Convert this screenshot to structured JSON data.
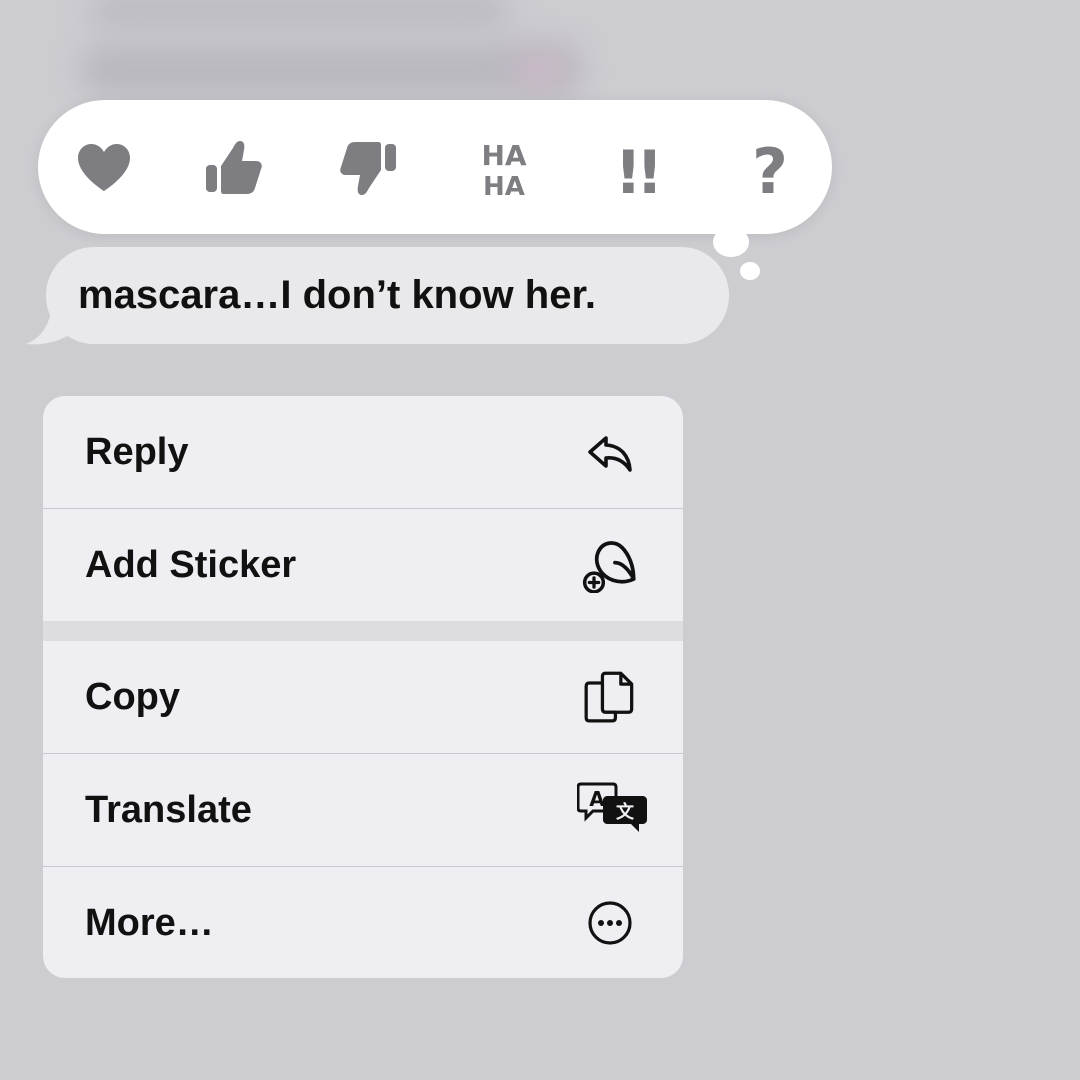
{
  "background": {
    "color": "#cdccd1"
  },
  "tapbacks": [
    {
      "name": "heart",
      "icon": "heart-icon"
    },
    {
      "name": "thumbs-up",
      "icon": "thumbs-up-icon"
    },
    {
      "name": "thumbs-down",
      "icon": "thumbs-down-icon"
    },
    {
      "name": "haha",
      "icon": "haha-icon",
      "text_top": "HA",
      "text_bottom": "HA"
    },
    {
      "name": "emphasize",
      "icon": "double-exclamation-icon",
      "text": "!!"
    },
    {
      "name": "question",
      "icon": "question-mark-icon",
      "text": "?"
    }
  ],
  "tapback_color": "#7d7d82",
  "message": {
    "text": "mascara…I don’t know her."
  },
  "menu": {
    "items": [
      {
        "label": "Reply",
        "icon": "reply-icon"
      },
      {
        "label": "Add Sticker",
        "icon": "add-sticker-icon"
      },
      {
        "label": "Copy",
        "icon": "copy-icon"
      },
      {
        "label": "Translate",
        "icon": "translate-icon"
      },
      {
        "label": "More…",
        "icon": "more-icon"
      }
    ]
  }
}
